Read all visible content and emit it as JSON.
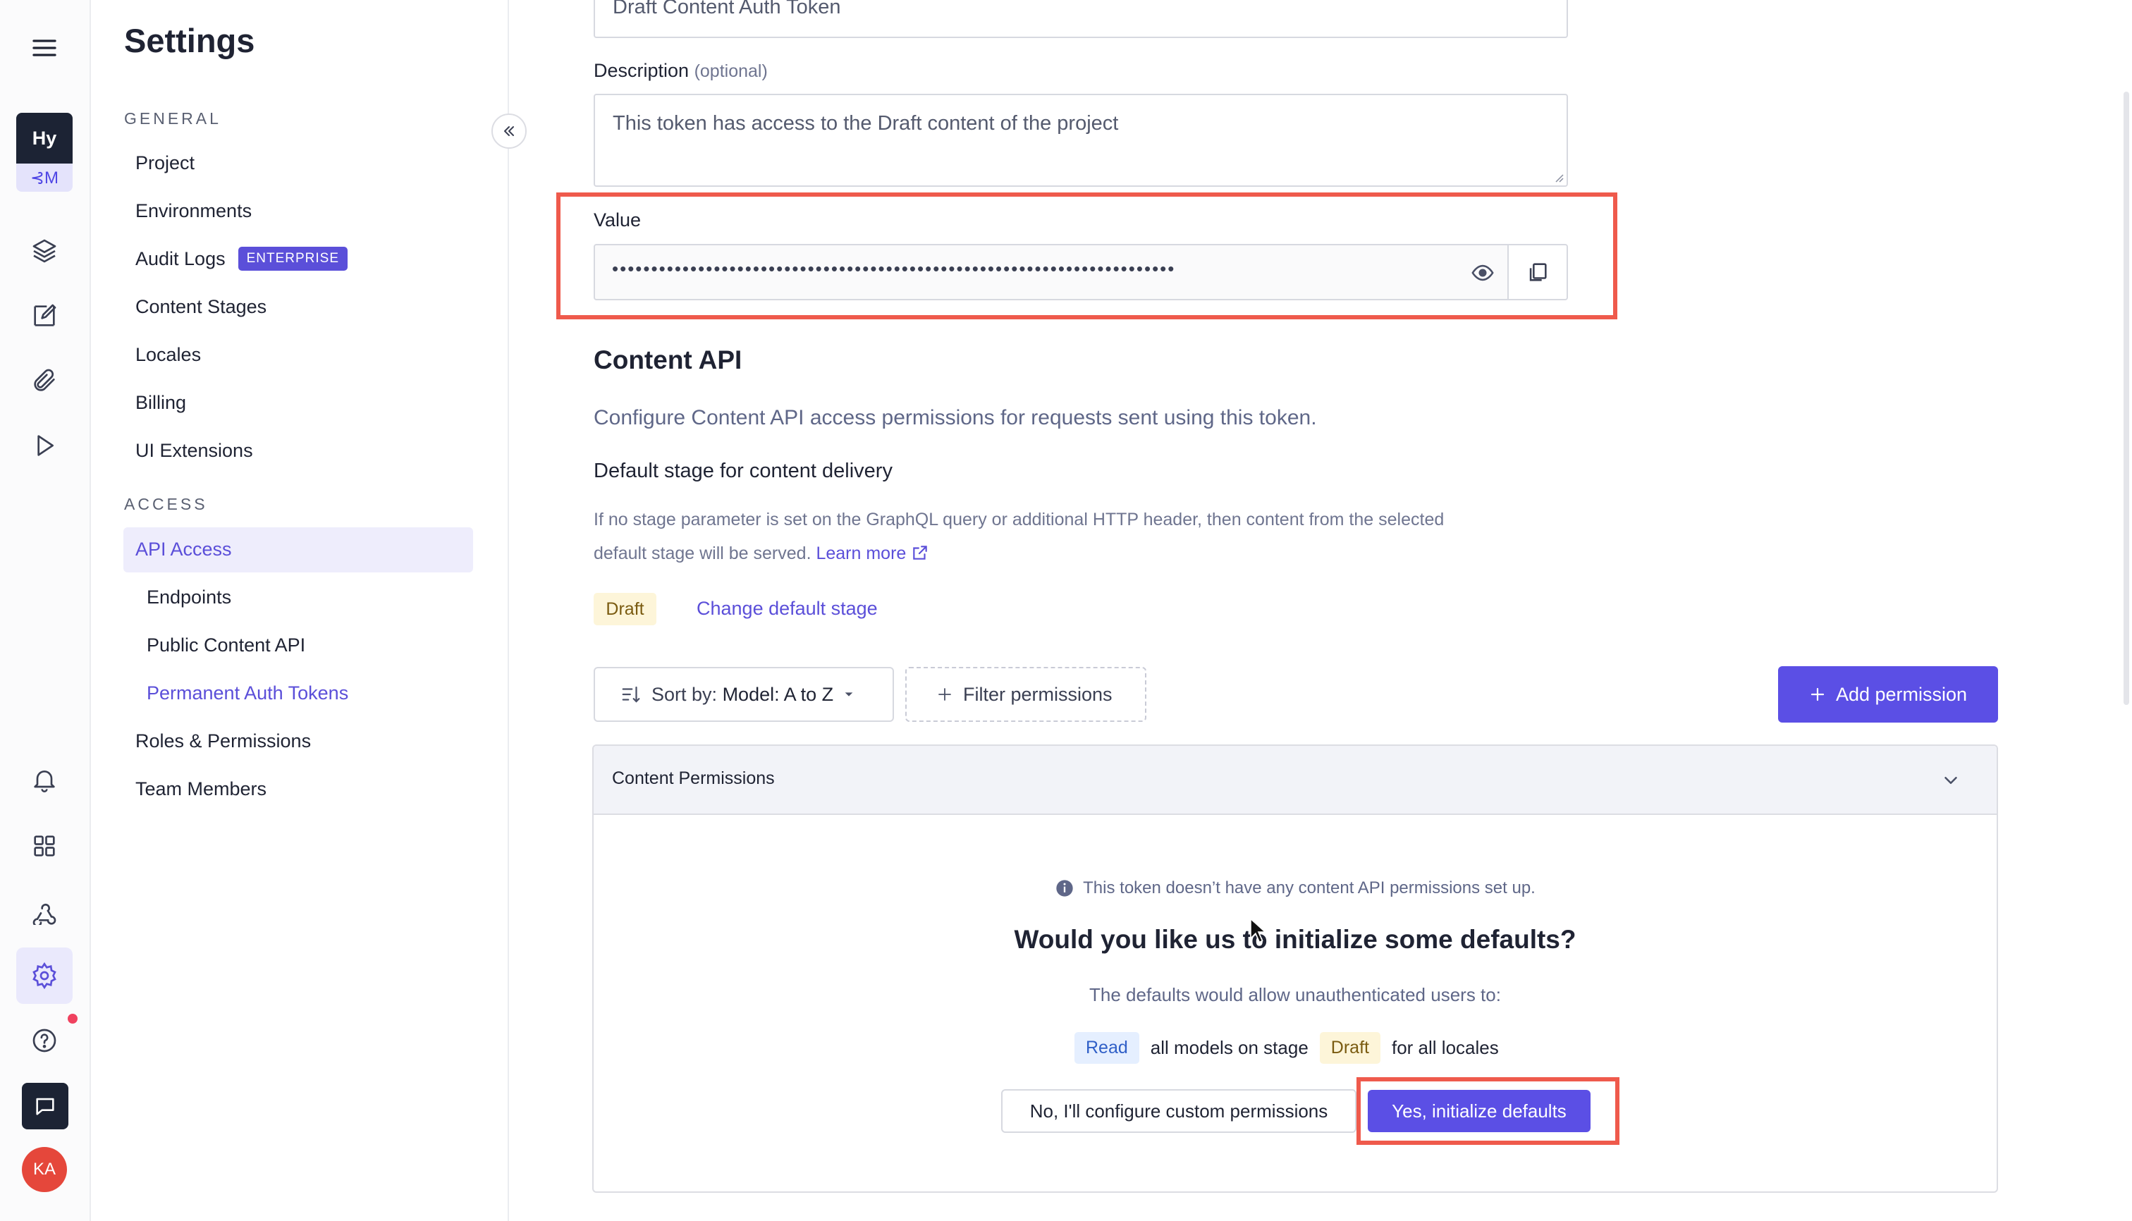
{
  "rail": {
    "project_initials": "Hy",
    "project_sub": "⊰M",
    "avatar_initials": "KA"
  },
  "sidebar": {
    "title": "Settings",
    "general_label": "GENERAL",
    "general_items": [
      {
        "label": "Project"
      },
      {
        "label": "Environments"
      },
      {
        "label": "Audit Logs",
        "badge": "ENTERPRISE"
      },
      {
        "label": "Content Stages"
      },
      {
        "label": "Locales"
      },
      {
        "label": "Billing"
      },
      {
        "label": "UI Extensions"
      }
    ],
    "access_label": "ACCESS",
    "access_items": [
      {
        "label": "API Access"
      },
      {
        "label": "Endpoints"
      },
      {
        "label": "Public Content API"
      },
      {
        "label": "Permanent Auth Tokens"
      },
      {
        "label": "Roles & Permissions"
      },
      {
        "label": "Team Members"
      }
    ]
  },
  "form": {
    "name_value": "Draft Content Auth Token",
    "description_label": "Description",
    "description_optional": "(optional)",
    "description_value": "This token has access to the Draft content of the project",
    "value_label": "Value",
    "value_masked": "••••••••••••••••••••••••••••••••••••••••••••••••••••••••••••••••••••••••"
  },
  "content_api": {
    "title": "Content API",
    "subtitle": "Configure Content API access permissions for requests sent using this token.",
    "default_stage_title": "Default stage for content delivery",
    "default_stage_desc_1": "If no stage parameter is set on the GraphQL query or additional HTTP header, then content from the selected",
    "default_stage_desc_2": "default stage will be served.",
    "learn_more": "Learn more",
    "stage_chip": "Draft",
    "change_stage_link": "Change default stage"
  },
  "toolbar": {
    "sort_prefix": "Sort by:",
    "sort_value": "Model: A to Z",
    "filter_label": "Filter permissions",
    "add_label": "Add permission"
  },
  "permissions": {
    "panel_title": "Content Permissions",
    "info_text": "This token doesn’t have any content API permissions set up.",
    "question": "Would you like us to initialize some defaults?",
    "defaults_intro": "The defaults would allow unauthenticated users to:",
    "read_chip": "Read",
    "models_text": "all models on stage",
    "draft_chip": "Draft",
    "locales_text": "for all locales",
    "no_button": "No, I'll configure custom permissions",
    "yes_button": "Yes, initialize defaults"
  },
  "colors": {
    "accent": "#5b4fd9",
    "annotation": "#ef5a4c",
    "draft_chip_bg": "#fdf5d9",
    "read_chip_bg": "#e5efff"
  }
}
